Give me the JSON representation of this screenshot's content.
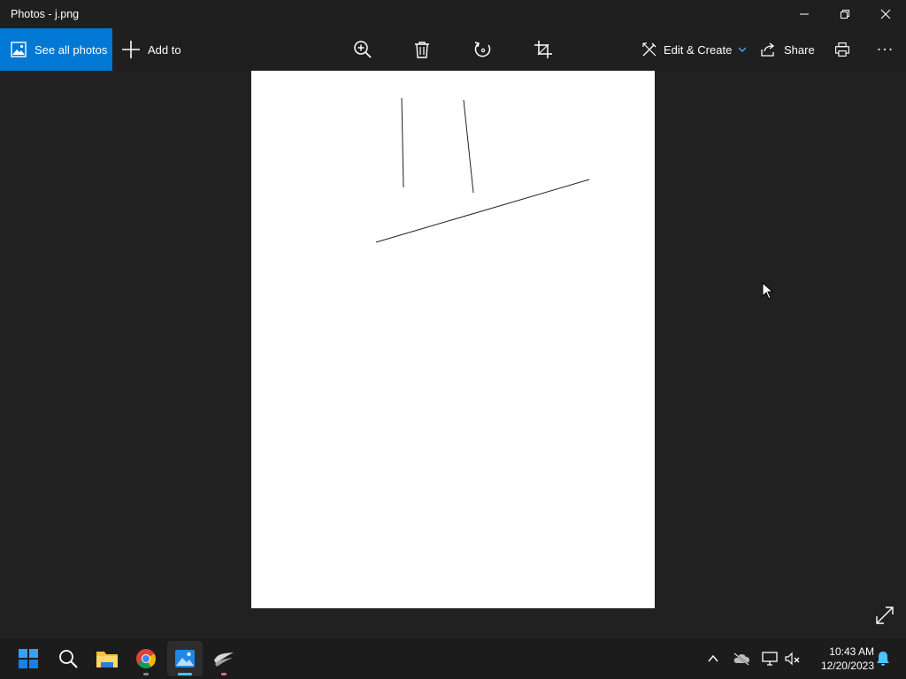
{
  "window": {
    "title": "Photos - j.png"
  },
  "toolbar": {
    "see_all_label": "See all photos",
    "add_to_label": "Add to",
    "edit_create_label": "Edit & Create",
    "share_label": "Share",
    "more_label": "..."
  },
  "taskbar": {
    "time": "10:43 AM",
    "date": "12/20/2023"
  },
  "colors": {
    "accent": "#0078d4",
    "background": "#212121",
    "photo_bg": "#ffffff"
  },
  "icons": [
    "zoom-in-icon",
    "delete-icon",
    "rotate-icon",
    "crop-icon",
    "edit-create-icon",
    "share-icon",
    "print-icon",
    "more-icon",
    "expand-icon"
  ]
}
